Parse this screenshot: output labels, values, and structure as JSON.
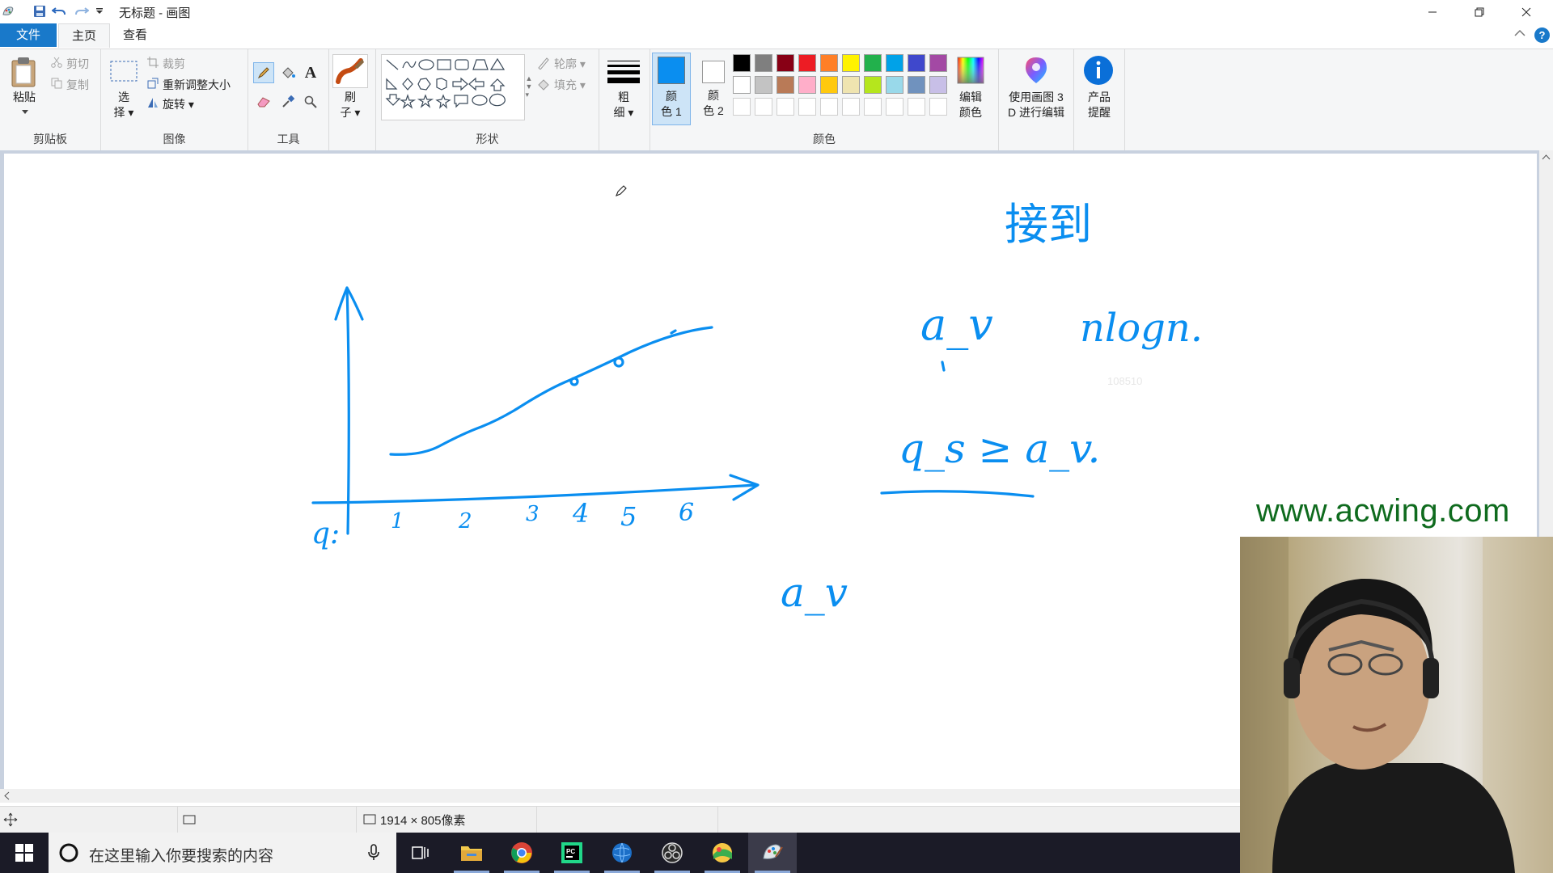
{
  "window": {
    "title": "无标题 - 画图",
    "quick_access": [
      "save-icon",
      "undo-icon",
      "redo-icon",
      "customize-icon"
    ]
  },
  "tabs": {
    "file": "文件",
    "home": "主页",
    "view": "查看"
  },
  "ribbon": {
    "clipboard": {
      "label": "剪贴板",
      "paste": "粘贴",
      "cut": "剪切",
      "copy": "复制"
    },
    "image": {
      "label": "图像",
      "select_top": "选",
      "select_bottom": "择",
      "crop": "裁剪",
      "resize": "重新调整大小",
      "rotate": "旋转"
    },
    "tools": {
      "label": "工具"
    },
    "brushes": {
      "top": "刷",
      "bottom": "子"
    },
    "shapes": {
      "label": "形状",
      "outline": "轮廓",
      "fill": "填充"
    },
    "size": {
      "top": "粗",
      "bottom": "细"
    },
    "colors": {
      "label": "颜色",
      "color1_top": "颜",
      "color1_bottom": "色 1",
      "color2_top": "颜",
      "color2_bottom": "色 2",
      "color1_value": "#0a8ef0",
      "color2_value": "#ffffff",
      "palette_row1": [
        "#000000",
        "#7f7f7f",
        "#880015",
        "#ed1c24",
        "#ff7f27",
        "#fff200",
        "#22b14c",
        "#00a2e8",
        "#3f48cc",
        "#a349a4"
      ],
      "palette_row2": [
        "#ffffff",
        "#c3c3c3",
        "#b97a57",
        "#ffaec9",
        "#ffc90e",
        "#efe4b0",
        "#b5e61d",
        "#99d9ea",
        "#7092be",
        "#c8bfe7"
      ],
      "edit_top": "编辑",
      "edit_bottom": "颜色"
    },
    "paint3d": {
      "top": "使用画图 3",
      "bottom": "D 进行编辑"
    },
    "product": {
      "top": "产品",
      "bottom": "提醒"
    }
  },
  "canvas": {
    "stroke_color": "#0a8ef0",
    "handwriting": {
      "axis_ticks": [
        "1",
        "2",
        "3",
        "4",
        "5",
        "6"
      ],
      "axis_label": "q:",
      "note_top": "接到",
      "note_av": "a_v",
      "note_nlogn": "nlogn.",
      "note_ineq": "q_s ≥ a_v.",
      "note_bottom": "a_v"
    },
    "faint_text": "108510"
  },
  "statusbar": {
    "dimensions": "1914 × 805像素"
  },
  "taskbar": {
    "search_placeholder": "在这里输入你要搜索的内容",
    "apps": [
      "task-view-icon",
      "file-explorer-icon",
      "chrome-icon",
      "pycharm-icon",
      "network-globe-icon",
      "obs-icon",
      "colorful-app-icon",
      "paint-icon"
    ]
  },
  "overlay": {
    "watermark": "www.acwing.com"
  }
}
